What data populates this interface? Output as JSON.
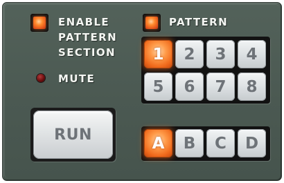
{
  "section": {
    "enable_label_line1": "ENABLE",
    "enable_label_line2": "PATTERN",
    "enable_label_line3": "SECTION",
    "enable_led_on": true
  },
  "mute": {
    "label": "MUTE",
    "led_on": false
  },
  "pattern": {
    "label": "PATTERN",
    "led_on": true,
    "numbers": [
      "1",
      "2",
      "3",
      "4",
      "5",
      "6",
      "7",
      "8"
    ],
    "selected_number": "1",
    "banks": [
      "A",
      "B",
      "C",
      "D"
    ],
    "selected_bank": "A"
  },
  "run": {
    "label": "RUN"
  },
  "colors": {
    "panel": "#4f5d56",
    "led_on": "#ff7a2a",
    "pad_face": "#e0e3e5",
    "pad_text": "#6e7378"
  }
}
